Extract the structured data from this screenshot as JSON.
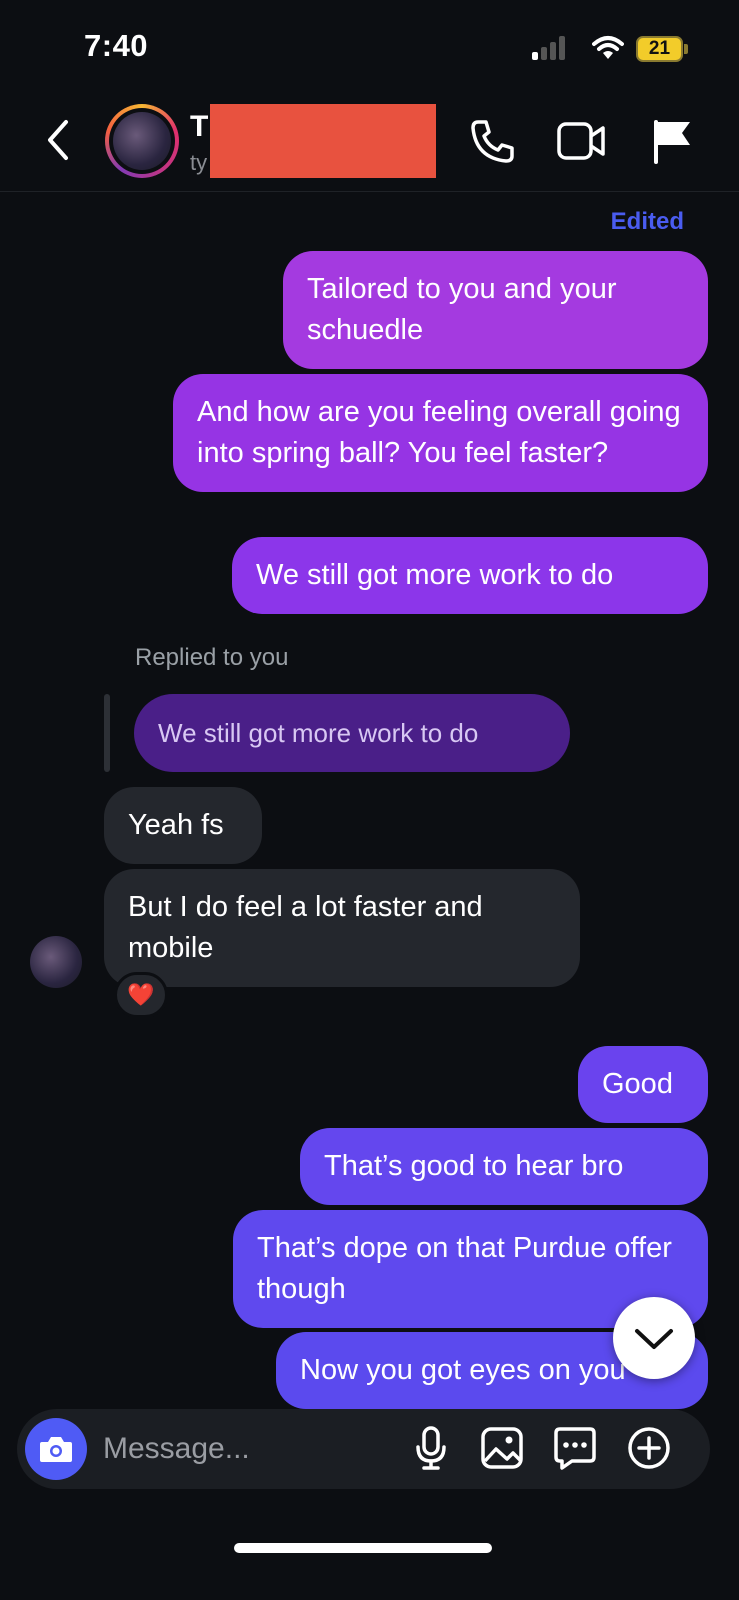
{
  "status_bar": {
    "time": "7:40",
    "battery_level": "21",
    "signal_bars_filled": 1,
    "icons": [
      "signal-icon",
      "wifi-icon",
      "battery-icon"
    ]
  },
  "header": {
    "name_initial": "T",
    "username_partial": "ty",
    "icons": [
      "back-icon",
      "phone-icon",
      "video-icon",
      "flag-icon"
    ]
  },
  "messages": {
    "edited_label": "Edited",
    "sent_1": "Tailored to you and your schuedle",
    "sent_2": "And how are you feeling overall going into spring ball? You feel faster?",
    "sent_3": "We still got more work to do",
    "replied_label": "Replied to you",
    "reply_quote": "We still got more work to do",
    "received_1": "Yeah fs",
    "received_2": "But I do feel a lot faster and mobile",
    "reaction": "❤️",
    "sent_4": "Good",
    "sent_5": "That’s good to hear bro",
    "sent_6": "That’s dope on that Purdue offer though",
    "sent_7": "Now you got eyes on you"
  },
  "composer": {
    "placeholder": "Message...",
    "icons": [
      "camera-icon",
      "microphone-icon",
      "gallery-icon",
      "sticker-icon",
      "plus-icon"
    ]
  },
  "colors": {
    "background": "#0c0e12",
    "edited": "#4a5cf0",
    "sent_top": "#a43ae0",
    "sent_bottom": "#5b4aee",
    "received": "#24272d",
    "camera_button": "#4f5bf5",
    "redaction": "#e8523f"
  }
}
